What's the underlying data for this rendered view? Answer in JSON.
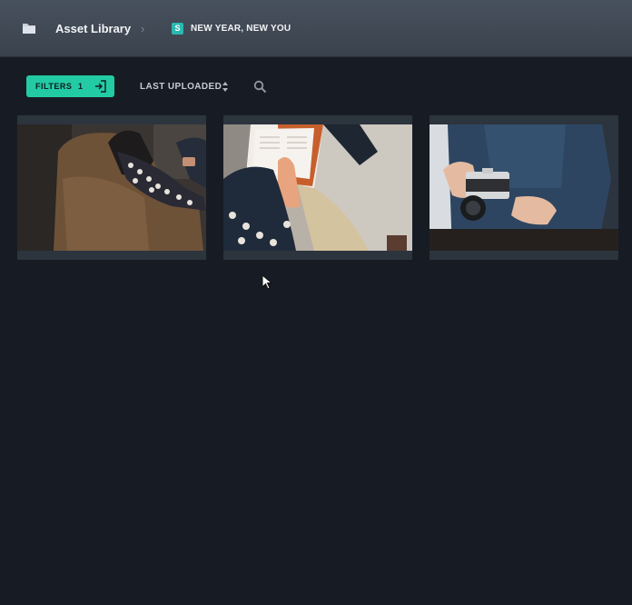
{
  "header": {
    "icon": "folder-icon",
    "title": "Asset Library",
    "separator": "›",
    "badge_letter": "S",
    "current": "NEW YEAR, NEW YOU",
    "badge_color": "#2bb8b0"
  },
  "toolbar": {
    "filters_label": "FILTERS",
    "filters_count": "1",
    "filters_icon": "enter-icon",
    "filters_color": "#22cba3",
    "sort_label": "LAST UPLOADED",
    "sort_icon": "sort-arrows-icon",
    "search_icon": "search-icon"
  },
  "assets": [
    {
      "alt": "Woman sitting in armchair looking at phone"
    },
    {
      "alt": "Person reading a book on a couch"
    },
    {
      "alt": "Hands holding a film camera"
    }
  ]
}
